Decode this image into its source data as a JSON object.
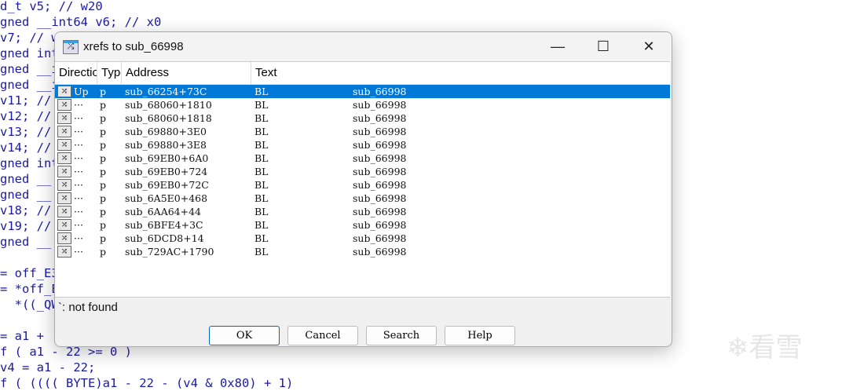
{
  "code_lines": [
    "d_t v5; // w20",
    "gned __int64 v6; // x0",
    "v7; // w",
    "gned int",
    "gned __i",
    "gned __i",
    "v11; //",
    "v12; //",
    "v13; //",
    "v14; //",
    "gned int",
    "gned __",
    "gned __",
    "v18; //",
    "v19; //",
    "gned __",
    "",
    "= off_E32",
    "= *off_E",
    "  *((_QWO",
    "",
    "= a1 +",
    "f ( a1 - 22 >= 0 )",
    "v4 = a1 - 22;",
    "f ( (((( BYTE)a1 - 22 - (v4 & 0x80) + 1)"
  ],
  "dialog": {
    "title": "xrefs to sub_66998",
    "columns": [
      "Direction",
      "Type",
      "Address",
      "Text"
    ],
    "rows": [
      {
        "dir": "Up",
        "type": "p",
        "address": "sub_66254+73C",
        "text": "BL",
        "target": "sub_66998"
      },
      {
        "dir": "···",
        "type": "p",
        "address": "sub_68060+1810",
        "text": "BL",
        "target": "sub_66998"
      },
      {
        "dir": "···",
        "type": "p",
        "address": "sub_68060+1818",
        "text": "BL",
        "target": "sub_66998"
      },
      {
        "dir": "···",
        "type": "p",
        "address": "sub_69880+3E0",
        "text": "BL",
        "target": "sub_66998"
      },
      {
        "dir": "···",
        "type": "p",
        "address": "sub_69880+3E8",
        "text": "BL",
        "target": "sub_66998"
      },
      {
        "dir": "···",
        "type": "p",
        "address": "sub_69EB0+6A0",
        "text": "BL",
        "target": "sub_66998"
      },
      {
        "dir": "···",
        "type": "p",
        "address": "sub_69EB0+724",
        "text": "BL",
        "target": "sub_66998"
      },
      {
        "dir": "···",
        "type": "p",
        "address": "sub_69EB0+72C",
        "text": "BL",
        "target": "sub_66998"
      },
      {
        "dir": "···",
        "type": "p",
        "address": "sub_6A5E0+468",
        "text": "BL",
        "target": "sub_66998"
      },
      {
        "dir": "···",
        "type": "p",
        "address": "sub_6AA64+44",
        "text": "BL",
        "target": "sub_66998"
      },
      {
        "dir": "···",
        "type": "p",
        "address": "sub_6BFE4+3C",
        "text": "BL",
        "target": "sub_66998"
      },
      {
        "dir": "···",
        "type": "p",
        "address": "sub_6DCD8+14",
        "text": "BL",
        "target": "sub_66998"
      },
      {
        "dir": "···",
        "type": "p",
        "address": "sub_729AC+1790",
        "text": "BL",
        "target": "sub_66998"
      }
    ],
    "status": "`: not found",
    "buttons": {
      "ok": "OK",
      "cancel": "Cancel",
      "search": "Search",
      "help": "Help"
    }
  },
  "watermark": "看雪"
}
